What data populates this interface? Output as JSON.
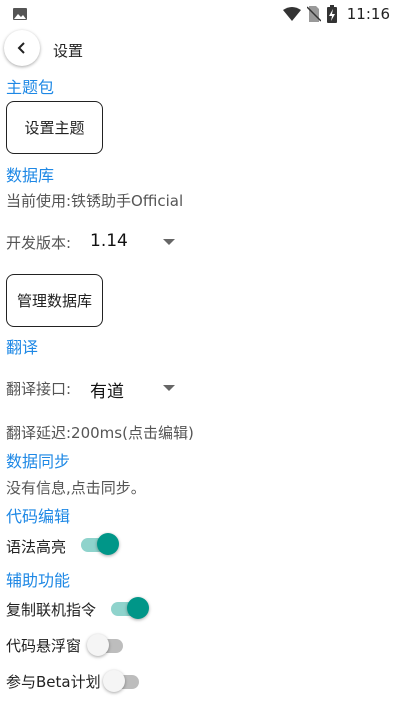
{
  "status_bar": {
    "time": "11:16",
    "icons": [
      "image-icon",
      "wifi-icon",
      "no-sim-icon",
      "battery-charging-icon"
    ]
  },
  "header": {
    "title": "设置",
    "back_icon": "back-arrow-icon"
  },
  "theme": {
    "section": "主题包",
    "set_theme_button": "设置主题"
  },
  "database": {
    "section": "数据库",
    "current": "当前使用:铁锈助手Official",
    "version_label": "开发版本:",
    "version_value": "1.14",
    "manage_button": "管理数据库"
  },
  "translate": {
    "section": "翻译",
    "api_label": "翻译接口:",
    "api_value": "有道",
    "delay_text": "翻译延迟:200ms(点击编辑)"
  },
  "sync": {
    "section": "数据同步",
    "info": "没有信息,点击同步。"
  },
  "code_edit": {
    "section": "代码编辑",
    "syntax_highlight": {
      "label": "语法高亮",
      "checked": true
    }
  },
  "assist": {
    "section": "辅助功能",
    "copy_command": {
      "label": "复制联机指令",
      "checked": true
    },
    "floating_window": {
      "label": "代码悬浮窗",
      "checked": false
    },
    "beta": {
      "label": "参与Beta计划",
      "checked": false
    }
  },
  "colors": {
    "accent": "#1e88e5",
    "switch_on": "#009688"
  }
}
